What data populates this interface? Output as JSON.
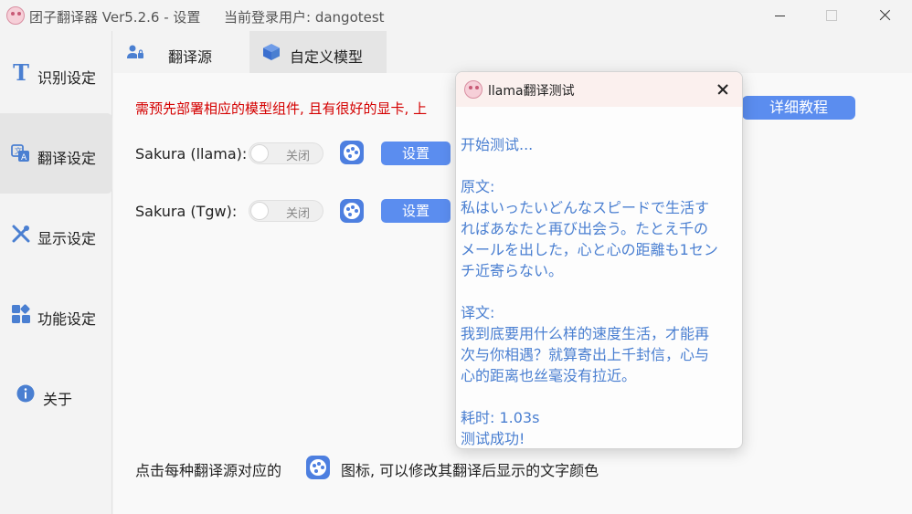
{
  "window": {
    "title": "团子翻译器 Ver5.2.6 - 设置",
    "user": "当前登录用户: dangotest"
  },
  "sidebar": {
    "items": [
      {
        "label": "识别设定",
        "icon": "text-t-icon"
      },
      {
        "label": "翻译设定",
        "icon": "translate-icon"
      },
      {
        "label": "显示设定",
        "icon": "tools-icon"
      },
      {
        "label": "功能设定",
        "icon": "apps-icon"
      },
      {
        "label": "关于",
        "icon": "info-icon"
      }
    ],
    "active": "翻译设定"
  },
  "tabs": [
    {
      "label": "翻译源",
      "icon": "user-lock-icon"
    },
    {
      "label": "自定义模型",
      "icon": "cube-icon"
    }
  ],
  "main": {
    "warning": "需预先部署相应的模型组件, 且有很好的显卡, 上",
    "tutorial_button": "详细教程",
    "rows": [
      {
        "label": "Sakura (llama):",
        "toggle": "关闭",
        "button": "设置"
      },
      {
        "label": "Sakura (Tgw):",
        "toggle": "关闭",
        "button": "设置"
      }
    ],
    "footer_before": "点击每种翻译源对应的",
    "footer_after": "图标, 可以修改其翻译后显示的文字颜色"
  },
  "dialog": {
    "title": "llama翻译测试",
    "lines": [
      "开始测试...",
      "原文:",
      "私はいったいどんなスピードで生活す",
      "ればあなたと再び出会う。たとえ千の",
      "メールを出した，心と心の距離も1セン",
      "チ近寄らない。",
      "译文:",
      "我到底要用什么样的速度生活，才能再",
      "次与你相遇？就算寄出上千封信，心与",
      "心的距离也丝毫没有拉近。",
      "耗时: 1.03s",
      "测试成功!"
    ]
  },
  "colors": {
    "accent": "#5b8def",
    "warning": "#d40000",
    "dialog_text": "#4a7fd1"
  }
}
